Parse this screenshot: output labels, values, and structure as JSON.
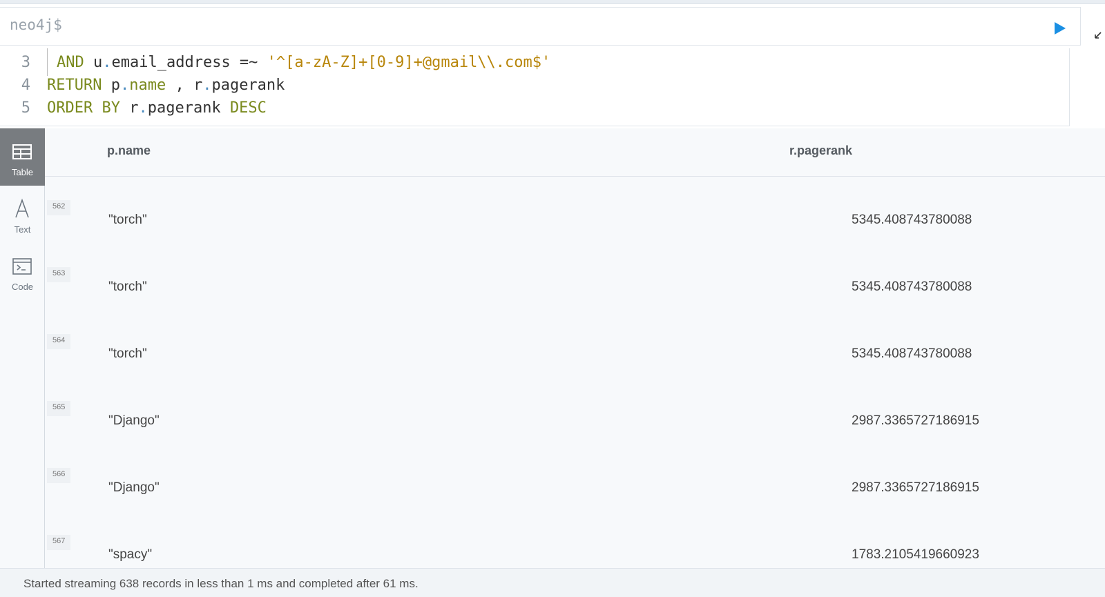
{
  "editor": {
    "prompt": "neo4j$",
    "run_icon": "play-icon",
    "expand_icon": "expand-icon"
  },
  "code": {
    "lines": [
      {
        "num": "3",
        "tokens": [
          {
            "t": "AND",
            "c": "kw"
          },
          {
            "t": " u",
            "c": ""
          },
          {
            "t": ".",
            "c": "dot"
          },
          {
            "t": "email_address =~ ",
            "c": ""
          },
          {
            "t": "'^[a-zA-Z]+[0-9]+@gmail\\\\.com$'",
            "c": "str"
          }
        ]
      },
      {
        "num": "4",
        "tokens": [
          {
            "t": "RETURN",
            "c": "kw"
          },
          {
            "t": " p",
            "c": ""
          },
          {
            "t": ".",
            "c": "dot"
          },
          {
            "t": "name",
            "c": "kw"
          },
          {
            "t": " , r",
            "c": ""
          },
          {
            "t": ".",
            "c": "dot"
          },
          {
            "t": "pagerank",
            "c": ""
          }
        ]
      },
      {
        "num": "5",
        "tokens": [
          {
            "t": "ORDER BY",
            "c": "kw"
          },
          {
            "t": " r",
            "c": ""
          },
          {
            "t": ".",
            "c": "dot"
          },
          {
            "t": "pagerank ",
            "c": ""
          },
          {
            "t": "DESC",
            "c": "kw"
          }
        ]
      }
    ]
  },
  "sidebar": {
    "views": [
      {
        "label": "Table",
        "icon": "table-icon",
        "active": true
      },
      {
        "label": "Text",
        "icon": "text-icon",
        "active": false
      },
      {
        "label": "Code",
        "icon": "code-icon",
        "active": false
      }
    ]
  },
  "table": {
    "columns": [
      "p.name",
      "r.pagerank"
    ],
    "rows": [
      {
        "num": "562",
        "name": "\"torch\"",
        "pagerank": "5345.408743780088"
      },
      {
        "num": "563",
        "name": "\"torch\"",
        "pagerank": "5345.408743780088"
      },
      {
        "num": "564",
        "name": "\"torch\"",
        "pagerank": "5345.408743780088"
      },
      {
        "num": "565",
        "name": "\"Django\"",
        "pagerank": "2987.3365727186915"
      },
      {
        "num": "566",
        "name": "\"Django\"",
        "pagerank": "2987.3365727186915"
      },
      {
        "num": "567",
        "name": "\"spacy\"",
        "pagerank": "1783.2105419660923"
      }
    ]
  },
  "status": {
    "text": "Started streaming 638 records in less than 1 ms and completed after 61 ms."
  }
}
